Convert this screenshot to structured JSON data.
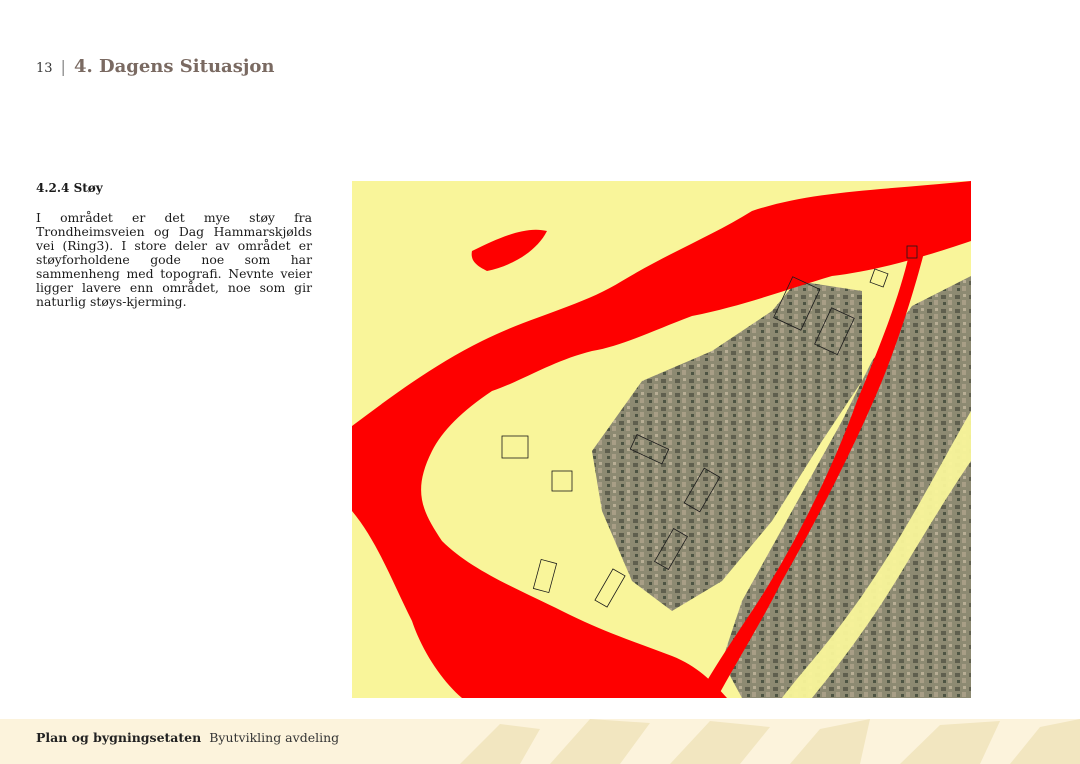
{
  "header": {
    "page_number": "13",
    "separator": "|",
    "chapter_title": "4. Dagens Situasjon"
  },
  "section": {
    "heading": "4.2.4 Støy",
    "body": "I området er det mye støy fra Trondheimsveien og Dag Hammarskjølds vei (Ring3). I store deler av området er støyforholdene gode noe som har sammenheng med topografi. Nevnte veier ligger lavere enn området, noe som gir naturlig støys-kjerming."
  },
  "map": {
    "colors": {
      "quiet_zone": "#f9f59a",
      "noise_zone": "#fe0000",
      "aerial": "#8b8570",
      "building_outline": "#1a1a1a"
    }
  },
  "footer": {
    "organization": "Plan og bygningsetaten",
    "department": "Byutvikling avdeling",
    "colors": {
      "background": "#fcf3dc",
      "pattern": "#f2e6c0"
    }
  }
}
